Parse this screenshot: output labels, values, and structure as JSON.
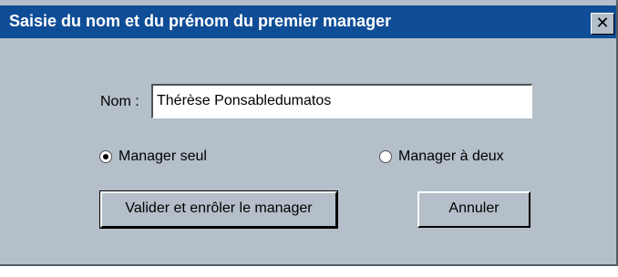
{
  "window": {
    "title": "Saisie du nom et du prénom du premier manager",
    "close_glyph": "✕"
  },
  "form": {
    "name_label": "Nom :",
    "name_value": "Thérèse Ponsabledumatos",
    "options": [
      {
        "label": "Manager seul",
        "selected": true
      },
      {
        "label": "Manager à deux",
        "selected": false
      }
    ]
  },
  "buttons": {
    "confirm_label": "Valider et enrôler le manager",
    "cancel_label": "Annuler"
  },
  "colors": {
    "title_bar": "#0f4d96",
    "dialog_background": "#b4bfc9"
  },
  "icons": {
    "close": "close-icon",
    "radio_selected": "radio-selected-icon",
    "radio_unselected": "radio-unselected-icon"
  }
}
